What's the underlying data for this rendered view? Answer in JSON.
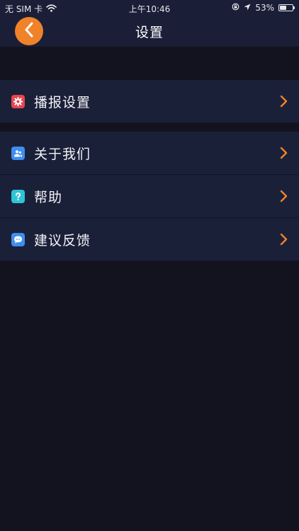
{
  "status_bar": {
    "carrier": "无 SIM 卡",
    "time": "上午10:46",
    "battery_text": "53%",
    "battery_level": 0.53,
    "icons": [
      "wifi-icon",
      "lock-rotation-icon",
      "location-arrow-icon",
      "battery-icon"
    ]
  },
  "nav": {
    "title": "设置",
    "back_icon": "chevron-left-icon",
    "accent_color": "#f0822a"
  },
  "settings_groups": [
    {
      "items": [
        {
          "label": "播报设置",
          "icon": "gear-icon",
          "icon_color": "#e8454e"
        }
      ]
    },
    {
      "items": [
        {
          "label": "关于我们",
          "icon": "people-icon",
          "icon_color": "#3d8ef0"
        },
        {
          "label": "帮助",
          "icon": "question-icon",
          "icon_color": "#2ec4d6"
        },
        {
          "label": "建议反馈",
          "icon": "chat-bubble-icon",
          "icon_color": "#3d8ef0"
        }
      ]
    }
  ],
  "colors": {
    "background": "#13131f",
    "bar": "#1a1e36",
    "row": "#1b2039",
    "chevron": "#f0822a"
  }
}
